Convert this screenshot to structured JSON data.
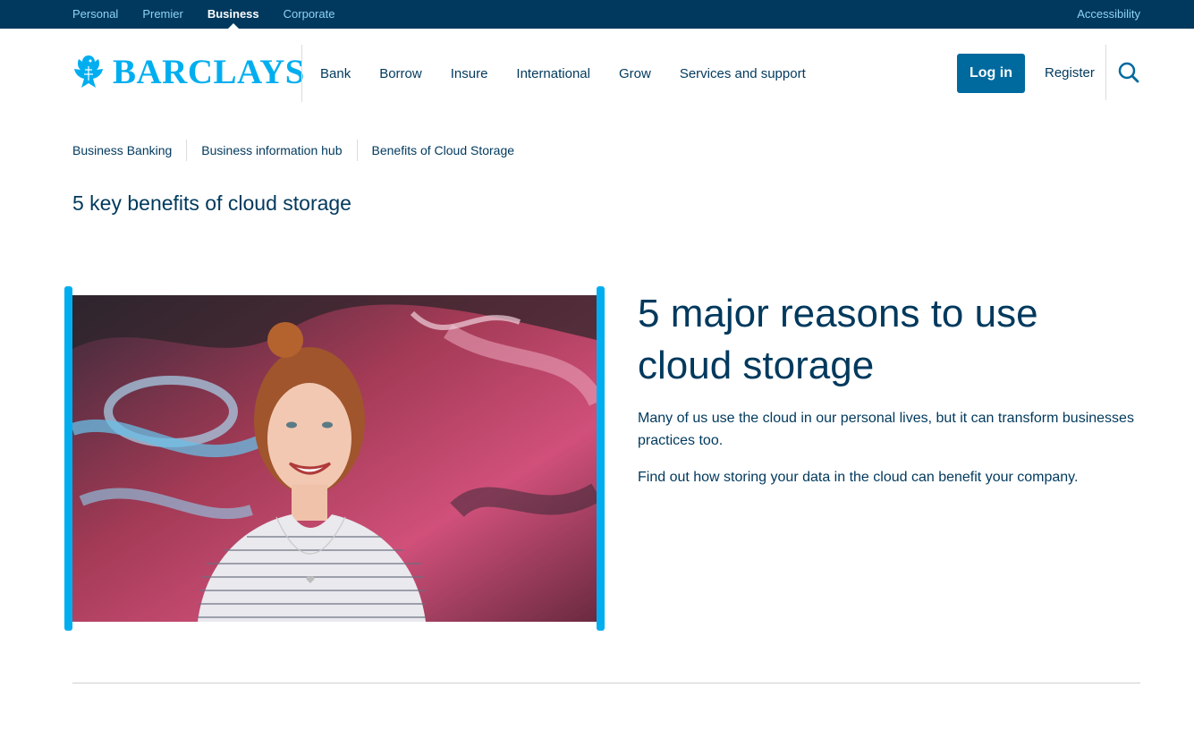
{
  "topbar": {
    "segments": [
      "Personal",
      "Premier",
      "Business",
      "Corporate"
    ],
    "active_segment": "Business",
    "accessibility": "Accessibility"
  },
  "header": {
    "logo_text": "BARCLAYS",
    "nav": [
      "Bank",
      "Borrow",
      "Insure",
      "International",
      "Grow",
      "Services and support"
    ],
    "login_label": "Log in",
    "register_label": "Register",
    "search_icon": "search-icon"
  },
  "breadcrumb": [
    "Business Banking",
    "Business information hub",
    "Benefits of Cloud Storage"
  ],
  "page_title": "5 key benefits of cloud storage",
  "hero": {
    "image_icon": "woman-smiling-graffiti-photo",
    "heading": "5 major reasons to use cloud storage",
    "paragraphs": [
      "Many of us use the cloud in our personal lives, but it can transform businesses practices too.",
      "Find out how storing your data in the cloud can benefit your company."
    ]
  },
  "colors": {
    "navy": "#00395d",
    "brand_blue": "#00aeef",
    "button_blue": "#006a9e",
    "topbar_link": "#8fd3f5"
  }
}
